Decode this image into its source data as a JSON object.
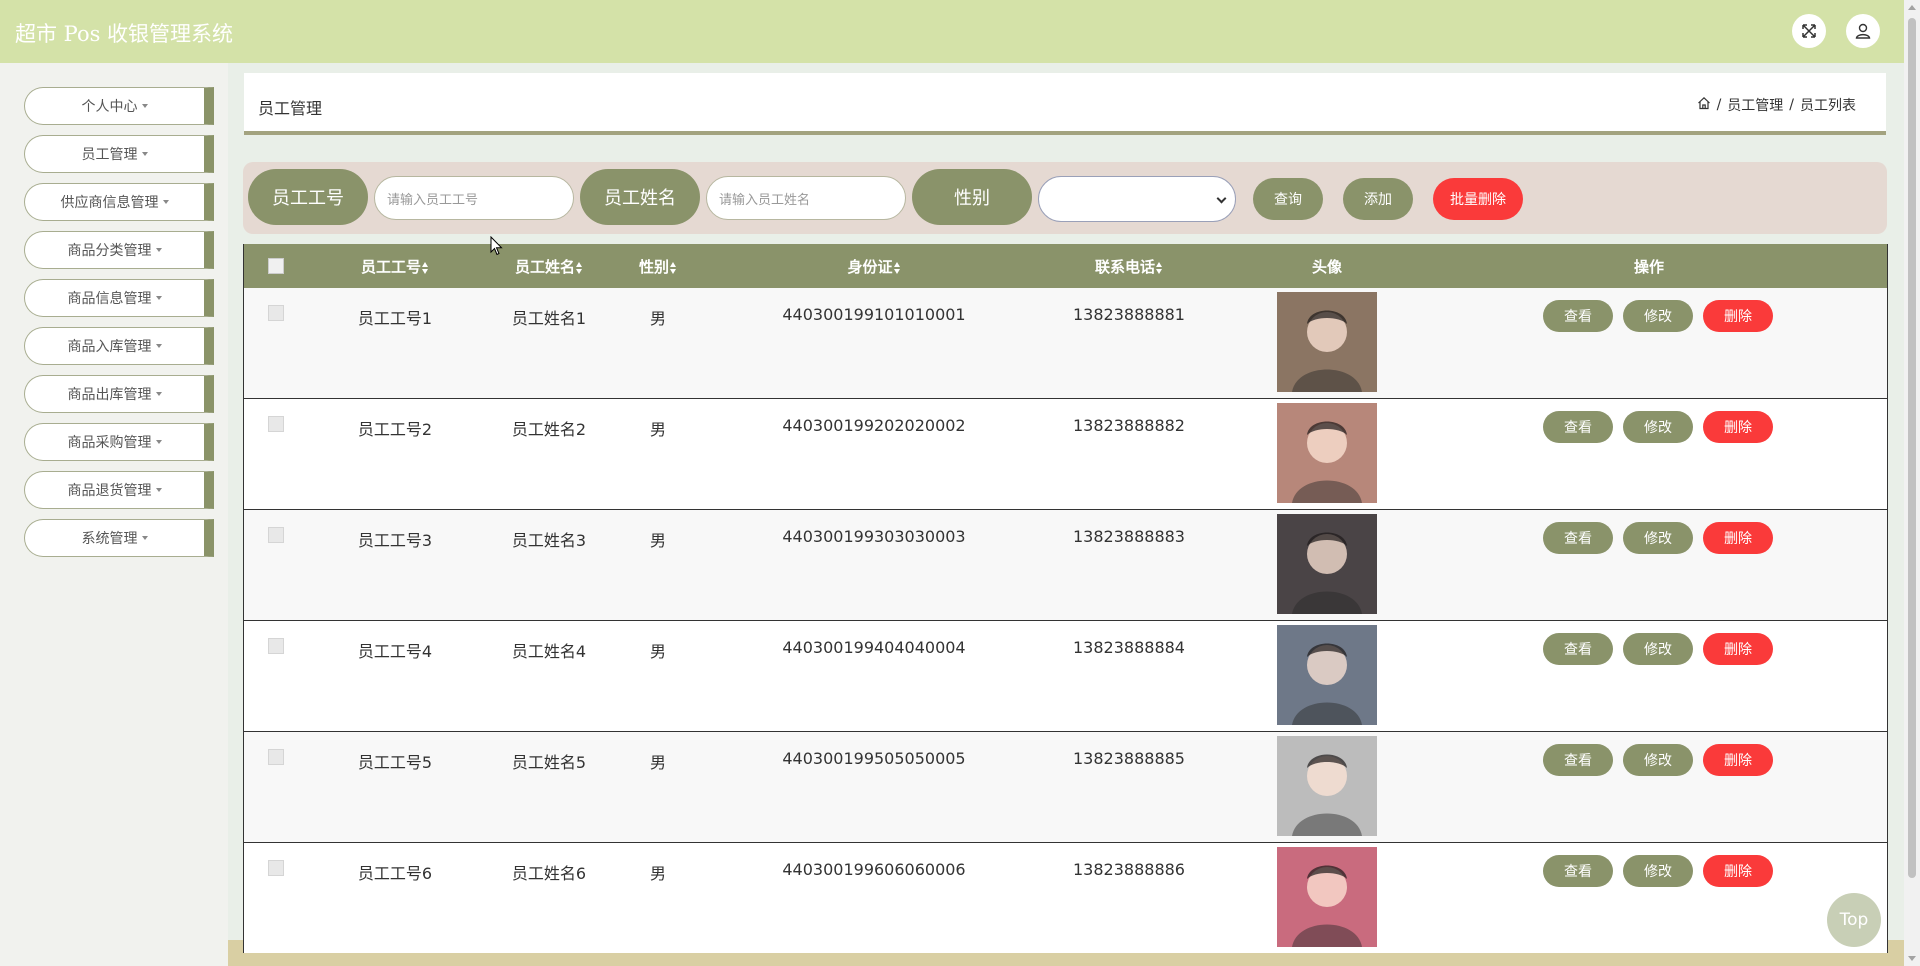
{
  "header": {
    "app_title": "超市 Pos 收银管理系统"
  },
  "sidebar": {
    "items": [
      {
        "label": "个人中心"
      },
      {
        "label": "员工管理"
      },
      {
        "label": "供应商信息管理"
      },
      {
        "label": "商品分类管理"
      },
      {
        "label": "商品信息管理"
      },
      {
        "label": "商品入库管理"
      },
      {
        "label": "商品出库管理"
      },
      {
        "label": "商品采购管理"
      },
      {
        "label": "商品退货管理"
      },
      {
        "label": "系统管理"
      }
    ]
  },
  "page": {
    "title": "员工管理",
    "breadcrumb": [
      "员工管理",
      "员工列表"
    ],
    "breadcrumb_sep": "/"
  },
  "search": {
    "id_label": "员工工号",
    "id_placeholder": "请输入员工工号",
    "name_label": "员工姓名",
    "name_placeholder": "请输入员工姓名",
    "gender_label": "性别",
    "gender_value": "",
    "query_button": "查询",
    "add_button": "添加",
    "batch_delete_button": "批量删除"
  },
  "table": {
    "columns": [
      "员工工号",
      "员工姓名",
      "性别",
      "身份证",
      "联系电话",
      "头像",
      "操作"
    ],
    "action_labels": {
      "view": "查看",
      "edit": "修改",
      "delete": "删除"
    },
    "rows": [
      {
        "id": "员工工号1",
        "name": "员工姓名1",
        "gender": "男",
        "id_card": "440300199101010001",
        "phone": "13823888881",
        "avatar_color": "#8b7563"
      },
      {
        "id": "员工工号2",
        "name": "员工姓名2",
        "gender": "男",
        "id_card": "440300199202020002",
        "phone": "13823888882",
        "avatar_color": "#b7877a"
      },
      {
        "id": "员工工号3",
        "name": "员工姓名3",
        "gender": "男",
        "id_card": "440300199303030003",
        "phone": "13823888883",
        "avatar_color": "#4a4446"
      },
      {
        "id": "员工工号4",
        "name": "员工姓名4",
        "gender": "男",
        "id_card": "440300199404040004",
        "phone": "13823888884",
        "avatar_color": "#6e7888"
      },
      {
        "id": "员工工号5",
        "name": "员工姓名5",
        "gender": "男",
        "id_card": "440300199505050005",
        "phone": "13823888885",
        "avatar_color": "#bcbcbc"
      },
      {
        "id": "员工工号6",
        "name": "员工姓名6",
        "gender": "男",
        "id_card": "440300199606060006",
        "phone": "13823888886",
        "avatar_color": "#c96b7e"
      }
    ]
  },
  "back_to_top": "Top",
  "colors": {
    "header_bg": "#d4e2a8",
    "olive": "#8a936a",
    "danger": "#fa3a3a",
    "search_bg": "#e5d9d2"
  }
}
